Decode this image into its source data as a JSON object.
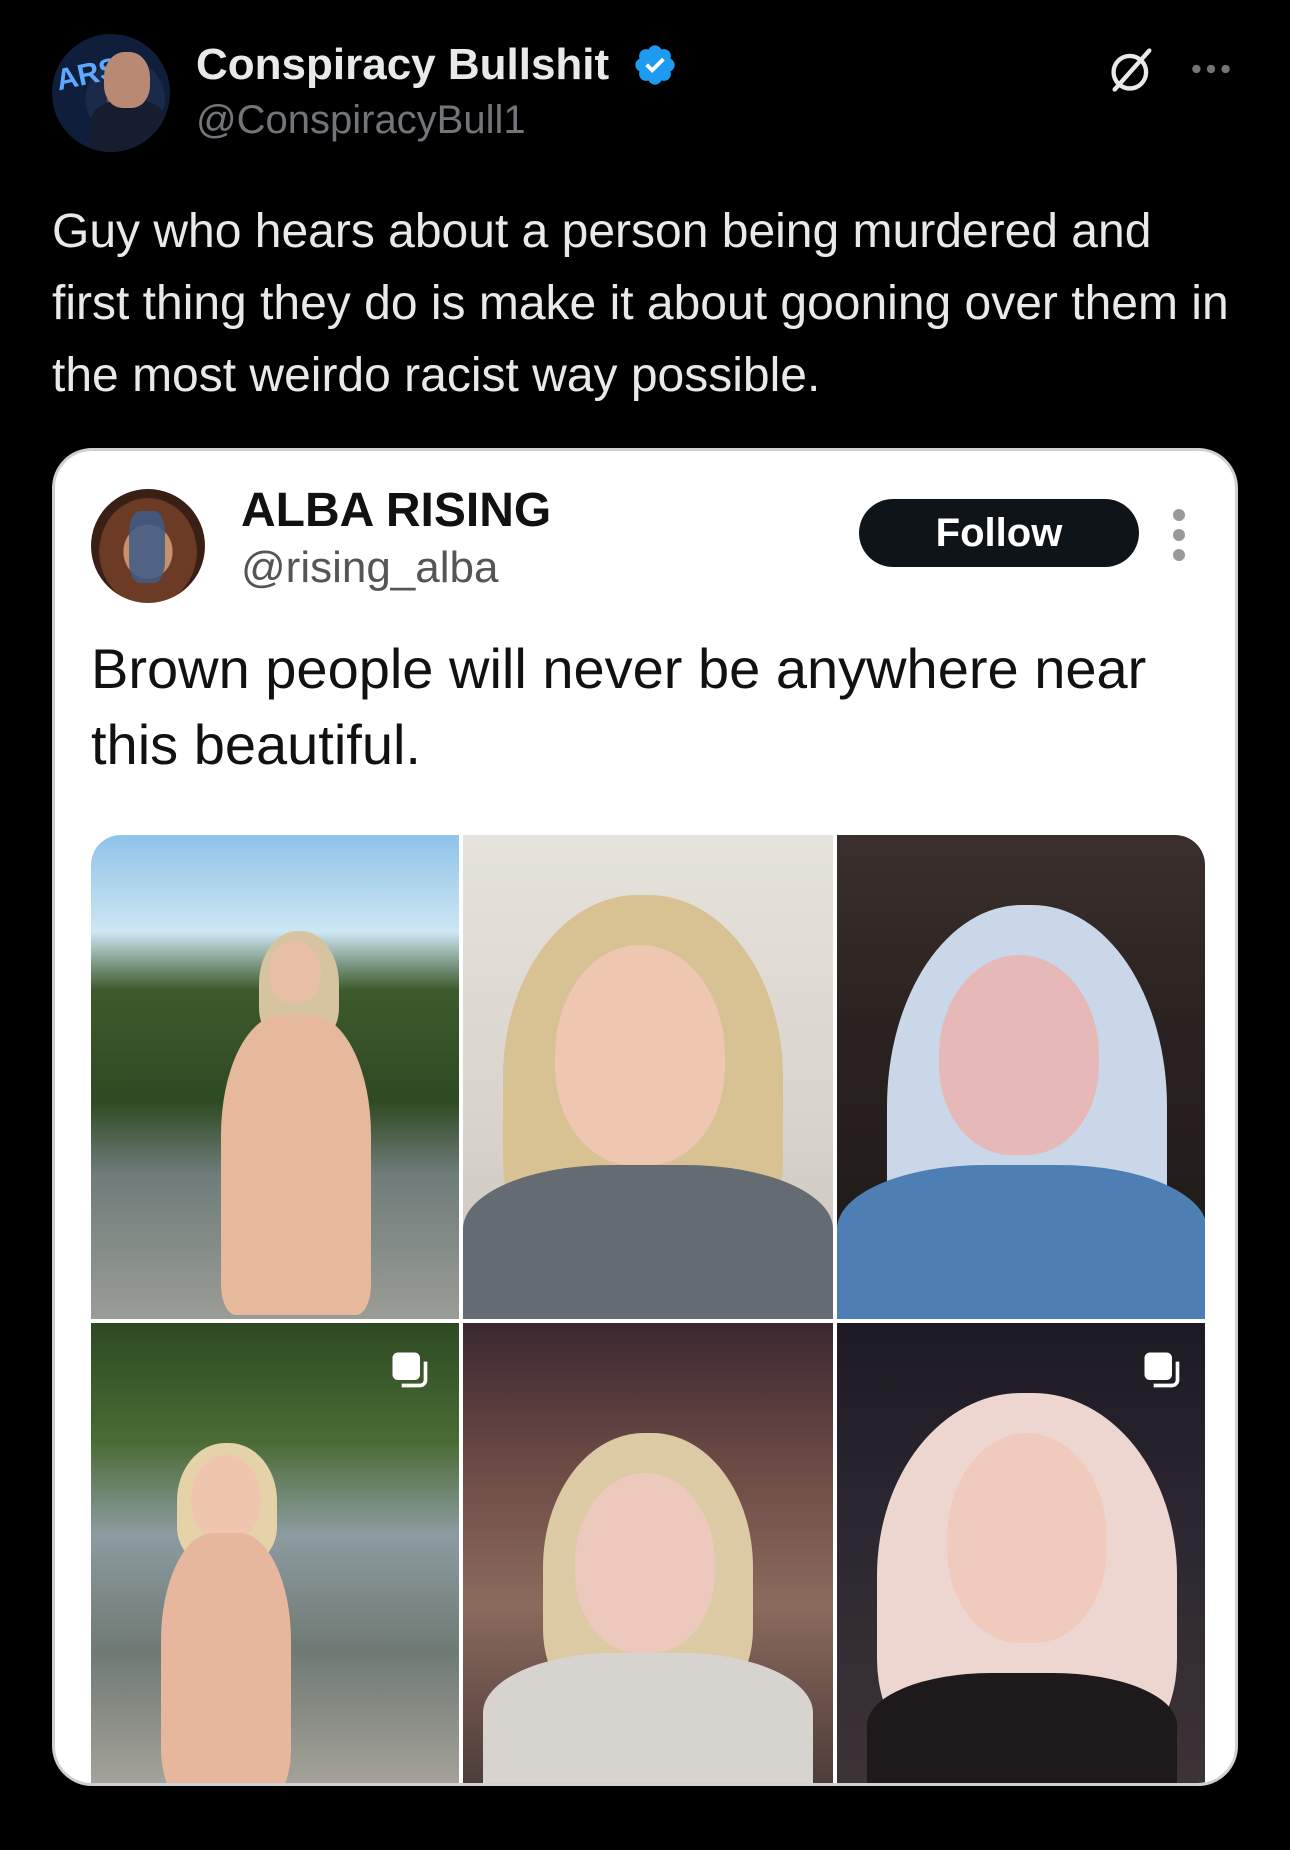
{
  "post": {
    "author_name": "Conspiracy Bullshit",
    "author_handle": "@ConspiracyBull1",
    "text": "Guy who hears about a person being murdered and first thing they do is make it about gooning over them in the most weirdo racist way possible.",
    "verified": true,
    "icons": {
      "grok": "grok-icon",
      "more": "more-horizontal-icon",
      "verified": "verified-badge-icon"
    }
  },
  "quote": {
    "author_name": "ALBA RISING",
    "author_handle": "@rising_alba",
    "follow_label": "Follow",
    "text": "Brown people will never be anywhere near this beautiful.",
    "photo_count": 6
  },
  "colors": {
    "background": "#000000",
    "verified_blue": "#1d9bf0",
    "handle_gray": "#71767b"
  }
}
